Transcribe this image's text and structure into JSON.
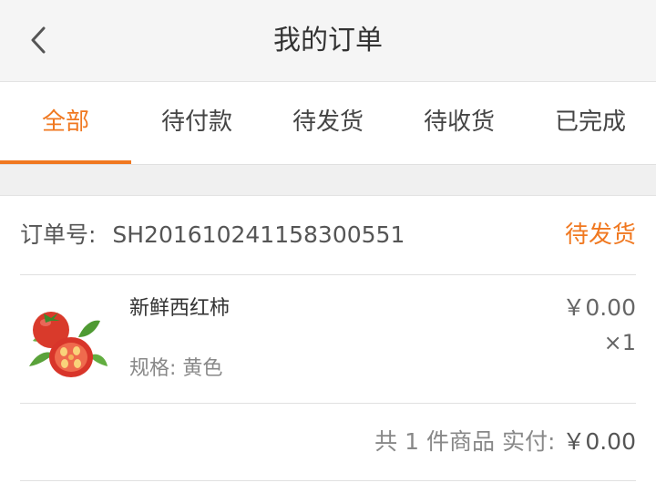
{
  "header": {
    "title": "我的订单",
    "back_icon": "chevron-left-icon"
  },
  "tabs": [
    {
      "label": "全部",
      "active": true
    },
    {
      "label": "待付款",
      "active": false
    },
    {
      "label": "待发货",
      "active": false
    },
    {
      "label": "待收货",
      "active": false
    },
    {
      "label": "已完成",
      "active": false
    }
  ],
  "order": {
    "number_label": "订单号:",
    "number": "SH201610241158300551",
    "status": "待发货",
    "item": {
      "name": "新鲜西红柿",
      "spec_label": "规格:",
      "spec_value": "黄色",
      "price": "￥0.00",
      "quantity": "×1",
      "image_icon": "tomato-icon"
    },
    "summary": {
      "prefix": "共",
      "count": "1",
      "unit": "件商品",
      "paid_label": "实付:",
      "amount": "￥0.00"
    }
  },
  "colors": {
    "accent": "#f07820",
    "header_bg": "#f5f5f5",
    "separator_bg": "#f0f0f0"
  }
}
